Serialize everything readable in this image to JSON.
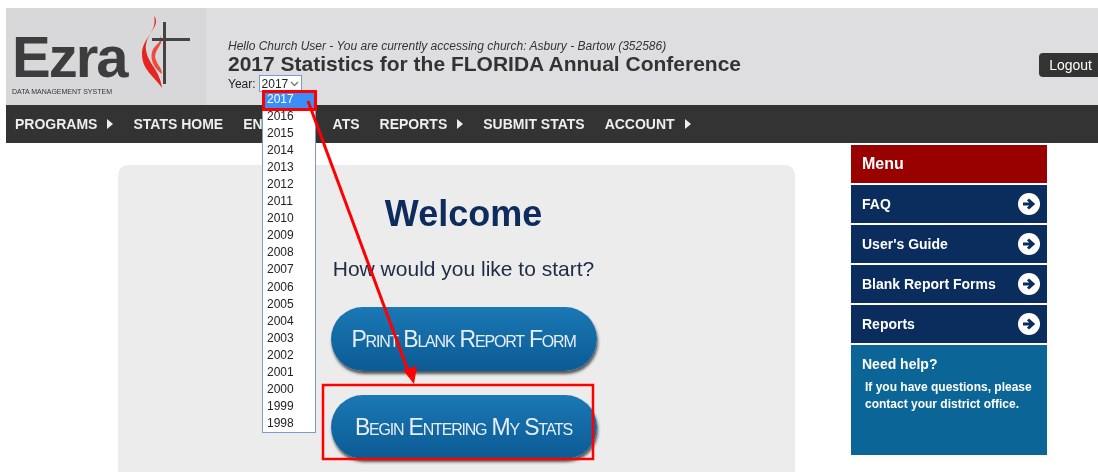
{
  "header": {
    "logo": {
      "wordmark": "Ezra",
      "tagline": "DATA MANAGEMENT SYSTEM"
    },
    "greeting": "Hello Church User - You are currently accessing church: Asbury - Bartow (352586)",
    "title": "2017 Statistics for the FLORIDA Annual Conference",
    "year_select": {
      "label": "Year:",
      "value": "2017",
      "expanded": true,
      "options": [
        {
          "label": "2017",
          "selected": true,
          "marked": true
        },
        {
          "label": "2016",
          "selected": false,
          "marked": false
        },
        {
          "label": "2015",
          "selected": false,
          "marked": false
        },
        {
          "label": "2014",
          "selected": false,
          "marked": false
        },
        {
          "label": "2013",
          "selected": false,
          "marked": false
        },
        {
          "label": "2012",
          "selected": false,
          "marked": false
        },
        {
          "label": "2011",
          "selected": false,
          "marked": false
        },
        {
          "label": "2010",
          "selected": false,
          "marked": false
        },
        {
          "label": "2009",
          "selected": false,
          "marked": false
        },
        {
          "label": "2008",
          "selected": false,
          "marked": false
        },
        {
          "label": "2007",
          "selected": false,
          "marked": false
        },
        {
          "label": "2006",
          "selected": false,
          "marked": false
        },
        {
          "label": "2005",
          "selected": false,
          "marked": false
        },
        {
          "label": "2004",
          "selected": false,
          "marked": false
        },
        {
          "label": "2003",
          "selected": false,
          "marked": false
        },
        {
          "label": "2002",
          "selected": false,
          "marked": false
        },
        {
          "label": "2001",
          "selected": false,
          "marked": false
        },
        {
          "label": "2000",
          "selected": false,
          "marked": false
        },
        {
          "label": "1999",
          "selected": false,
          "marked": false
        },
        {
          "label": "1998",
          "selected": false,
          "marked": false
        }
      ]
    },
    "logout": "Logout"
  },
  "nav": [
    {
      "label": "PROGRAMS",
      "submenu": true
    },
    {
      "label": "STATS HOME",
      "submenu": false
    },
    {
      "label": "EN",
      "label_end": "ATS",
      "submenu": false
    },
    {
      "label": "REPORTS",
      "submenu": true
    },
    {
      "label": "SUBMIT STATS",
      "submenu": false
    },
    {
      "label": "ACCOUNT",
      "submenu": true
    }
  ],
  "welcome": {
    "heading": "Welcome",
    "prompt": "How would you like to start?",
    "buttons": [
      {
        "label": "Print Blank Report Form",
        "marked": false
      },
      {
        "label": "Begin Entering My Stats",
        "marked": true
      }
    ]
  },
  "sidebar": {
    "title": "Menu",
    "items": [
      "FAQ",
      "User's Guide",
      "Blank Report Forms",
      "Reports"
    ],
    "help": {
      "title": "Need help?",
      "text": "If you have questions, please contact your district office."
    }
  }
}
